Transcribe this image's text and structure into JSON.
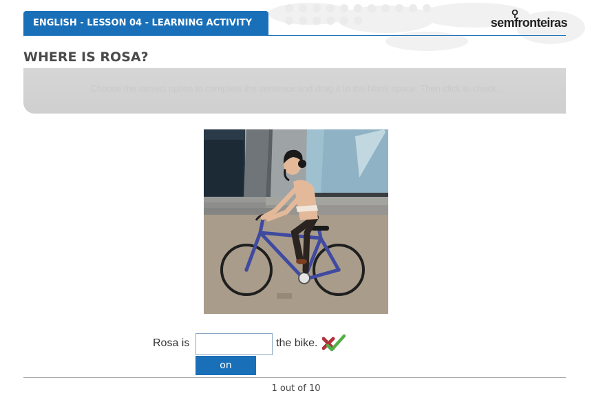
{
  "header": {
    "lesson_title": "ENGLISH - LESSON 04 - LEARNING ACTIVITY",
    "brand": "semfronteiras",
    "accent_color": "#1a70b8"
  },
  "activity": {
    "title": "WHERE IS ROSA?",
    "instructions": "Choose the correct option to complete the sentence and drag it to the blank space. Then click to check."
  },
  "image": {
    "icon": "woman-riding-bicycle-illustration"
  },
  "exercise": {
    "sentence_prefix": "Rosa is",
    "answer_value": "",
    "sentence_suffix": "the bike.",
    "options": [
      "on"
    ],
    "check_icon": "check-icon"
  },
  "footer": {
    "progress": "1 out of 10"
  }
}
